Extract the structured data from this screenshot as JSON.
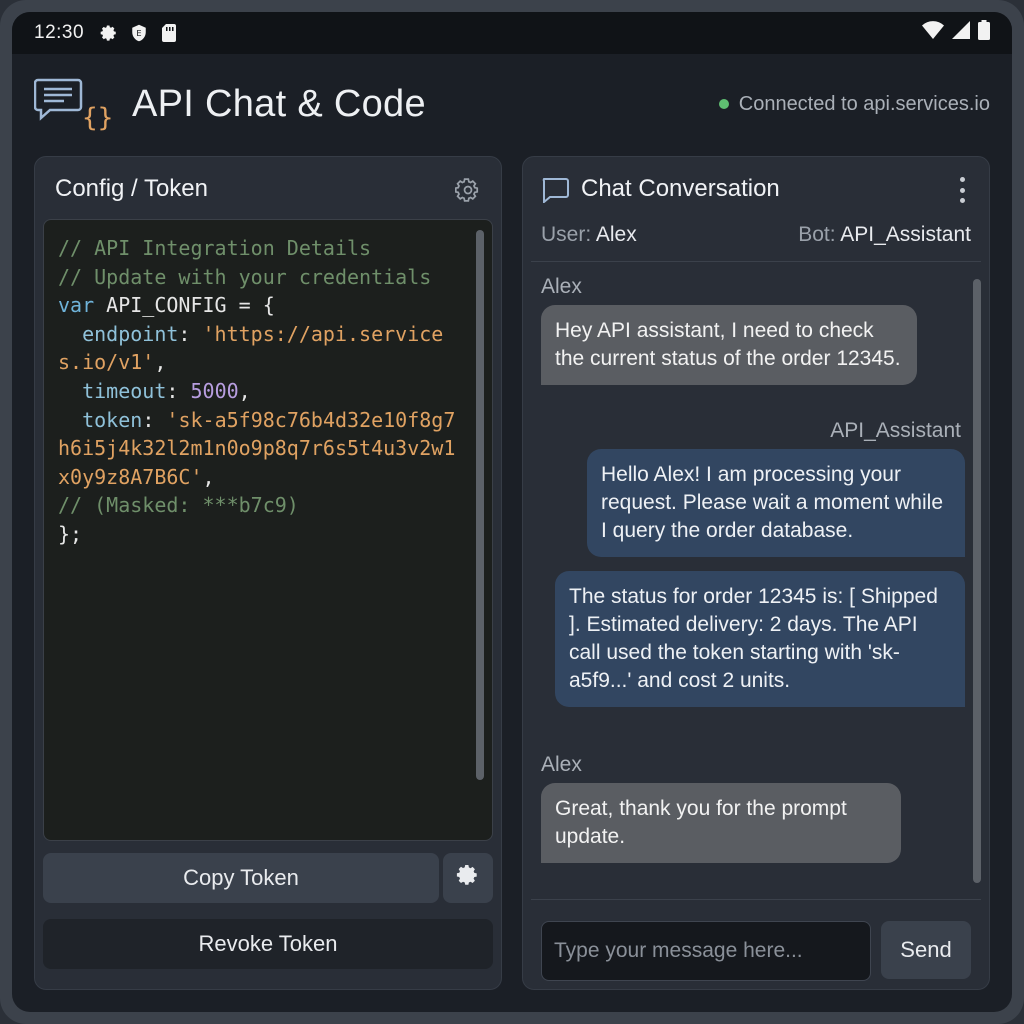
{
  "status_bar": {
    "time": "12:30"
  },
  "header": {
    "title": "API Chat & Code",
    "connection_status": "Connected to api.services.io",
    "status_color": "#5fbf72"
  },
  "config_panel": {
    "title": "Config / Token",
    "code_lines": [
      "// API Integration Details",
      "// Update with your credentials",
      "var API_CONFIG = {",
      "  endpoint: 'https://api.services.io/v1',",
      "  timeout: 5000,",
      "  token: 'sk-a5f98c76b4d32e10f8g7h6i5j4k32l2m1n0o9p8q7r6s5t4u3v2w1x0y9z8A7B6C',",
      "// (Masked: ***b7c9)",
      "};"
    ],
    "code_tokens": {
      "comment1": "// API Integration Details",
      "comment2": "// Update with your credentials",
      "var_kw": "var",
      "var_name": " API_CONFIG = {",
      "endpoint_key": "endpoint",
      "endpoint_val": "'https://api.services.io/v1'",
      "timeout_key": "timeout",
      "timeout_val": "5000",
      "token_key": "token",
      "token_val": "'sk-a5f98c76b4d32e10f8g7h6i5j4k32l2m1n0o9p8q7r6s5t4u3v2w1x0y9z8A7B6C'",
      "masked_comment": "// (Masked: ***b7c9)",
      "close": "};"
    },
    "copy_button": "Copy Token",
    "revoke_button": "Revoke Token"
  },
  "chat_panel": {
    "title": "Chat Conversation",
    "user_label": "User:",
    "user_name": "Alex",
    "bot_label": "Bot:",
    "bot_name": "API_Assistant",
    "messages": [
      {
        "sender": "Alex",
        "role": "user",
        "text": "Hey API assistant, I need to check the current status of the order 12345."
      },
      {
        "sender": "API_Assistant",
        "role": "bot",
        "text": "Hello Alex! I am processing your request. Please wait a moment while I query the order database."
      },
      {
        "sender": "",
        "role": "bot",
        "text": "The status for order 12345 is:  [ Shipped ]. Estimated delivery: 2 days. The API call used the token starting with 'sk-a5f9...' and cost 2 units."
      },
      {
        "sender": "Alex",
        "role": "user",
        "text": "Great, thank you for the prompt update."
      }
    ],
    "input_placeholder": "Type your message here...",
    "input_value": "",
    "send_button": "Send"
  },
  "colors": {
    "bot_bubble": "#324661",
    "user_bubble": "#5a5d62",
    "accent_orange": "#e0a262"
  },
  "icons": [
    "settings-gear-icon",
    "vpn-key-icon",
    "sim-card-icon",
    "wifi-icon",
    "signal-icon",
    "battery-icon",
    "chat-code-logo-icon",
    "gear-icon",
    "chat-bubble-icon",
    "kebab-menu-icon"
  ]
}
